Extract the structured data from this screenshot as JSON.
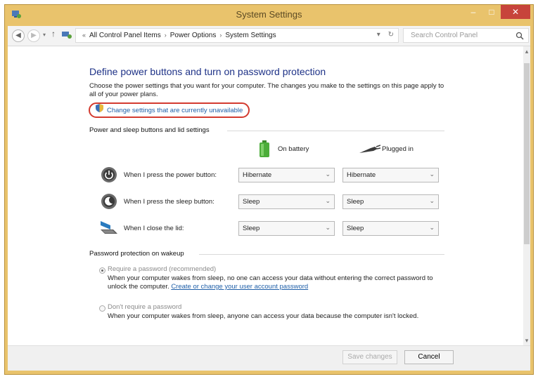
{
  "window": {
    "title": "System Settings",
    "controls": {
      "minimize": "–",
      "maximize": "□",
      "close": "✕"
    }
  },
  "address_bar": {
    "breadcrumbs": [
      "All Control Panel Items",
      "Power Options",
      "System Settings"
    ],
    "search_placeholder": "Search Control Panel"
  },
  "page": {
    "heading": "Define power buttons and turn on password protection",
    "description": "Choose the power settings that you want for your computer. The changes you make to the settings on this page apply to all of your power plans.",
    "change_settings_link": "Change settings that are currently unavailable"
  },
  "power_section": {
    "title": "Power and sleep buttons and lid settings",
    "columns": [
      "On battery",
      "Plugged in"
    ],
    "rows": [
      {
        "label": "When I press the power button:",
        "on_battery": "Hibernate",
        "plugged_in": "Hibernate"
      },
      {
        "label": "When I press the sleep button:",
        "on_battery": "Sleep",
        "plugged_in": "Sleep"
      },
      {
        "label": "When I close the lid:",
        "on_battery": "Sleep",
        "plugged_in": "Sleep"
      }
    ]
  },
  "password_section": {
    "title": "Password protection on wakeup",
    "option1": {
      "label": "Require a password (recommended)",
      "desc": "When your computer wakes from sleep, no one can access your data without entering the correct password to unlock the computer.",
      "link": "Create or change your user account password",
      "selected": true
    },
    "option2": {
      "label": "Don't require a password",
      "desc": "When your computer wakes from sleep, anyone can access your data because the computer isn't locked.",
      "selected": false
    }
  },
  "footer": {
    "save_label": "Save changes",
    "cancel_label": "Cancel"
  }
}
